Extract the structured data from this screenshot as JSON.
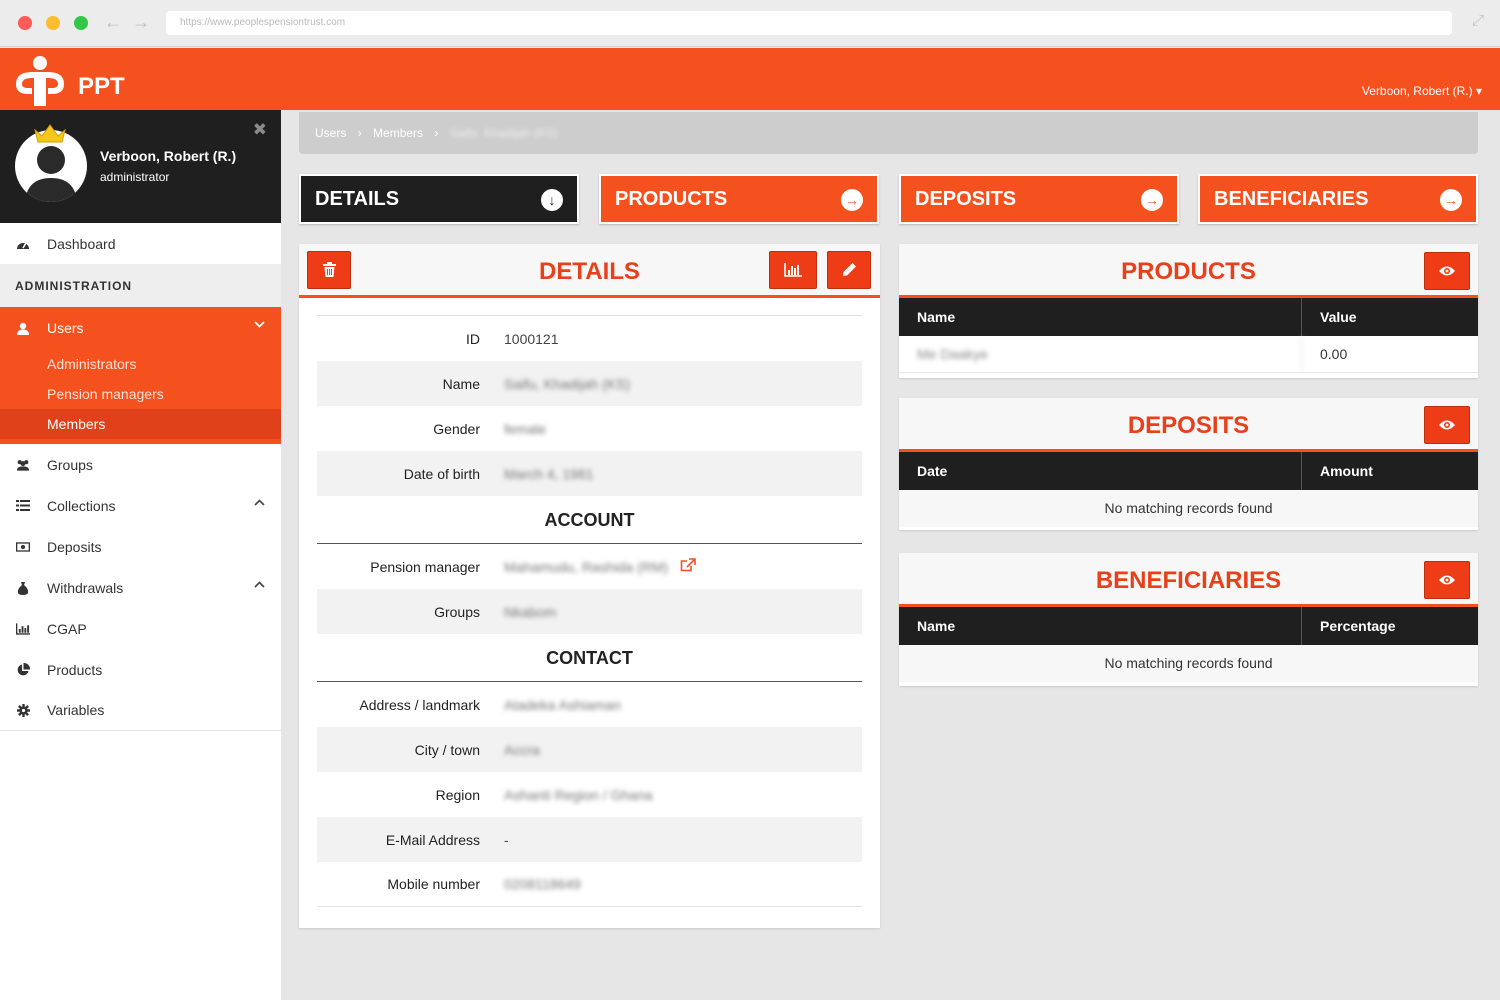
{
  "browser": {
    "url": "https://www.peoplespensiontrust.com"
  },
  "topbar": {
    "brand": "PPT",
    "user_menu": "Verboon, Robert (R.) ▾"
  },
  "sidebar": {
    "profile_name": "Verboon, Robert (R.)",
    "profile_role": "administrator",
    "close": "✖",
    "dashboard": "Dashboard",
    "section": "ADMINISTRATION",
    "users": "Users",
    "users_sub": [
      "Administrators",
      "Pension managers",
      "Members"
    ],
    "groups": "Groups",
    "collections": "Collections",
    "deposits": "Deposits",
    "withdrawals": "Withdrawals",
    "cgap": "CGAP",
    "products": "Products",
    "variables": "Variables"
  },
  "breadcrumb": {
    "items": [
      "Users",
      "Members",
      "Saifu, Khadijah (KS)"
    ],
    "separator": "›"
  },
  "tabs": {
    "details": "DETAILS",
    "products": "PRODUCTS",
    "deposits": "DEPOSITS",
    "beneficiaries": "BENEFICIARIES"
  },
  "details_panel": {
    "title": "DETAILS",
    "fields": {
      "id_label": "ID",
      "id_value": "1000121",
      "name_label": "Name",
      "name_value": "Saifu, Khadijah (KS)",
      "gender_label": "Gender",
      "gender_value": "female",
      "dob_label": "Date of birth",
      "dob_value": "March 4, 1981"
    },
    "account_head": "ACCOUNT",
    "account": {
      "pm_label": "Pension manager",
      "pm_value": "Mahamudu, Rashida (RM)",
      "groups_label": "Groups",
      "groups_value": "Nkabom"
    },
    "contact_head": "CONTACT",
    "contact": {
      "address_label": "Address / landmark",
      "address_value": "Atadeka Ashiaman",
      "city_label": "City / town",
      "city_value": "Accra",
      "region_label": "Region",
      "region_value": "Ashanti Region / Ghana",
      "email_label": "E-Mail Address",
      "email_value": "-",
      "mobile_label": "Mobile number",
      "mobile_value": "0208118649"
    }
  },
  "products_panel": {
    "title": "PRODUCTS",
    "columns": [
      "Name",
      "Value"
    ],
    "rows": [
      [
        "Me Daakye",
        "0.00"
      ]
    ]
  },
  "deposits_panel": {
    "title": "DEPOSITS",
    "columns": [
      "Date",
      "Amount"
    ],
    "empty": "No matching records found"
  },
  "beneficiaries_panel": {
    "title": "BENEFICIARIES",
    "columns": [
      "Name",
      "Percentage"
    ],
    "empty": "No matching records found"
  },
  "colors": {
    "accent": "#f4511e",
    "dark": "#1f1f1f"
  }
}
